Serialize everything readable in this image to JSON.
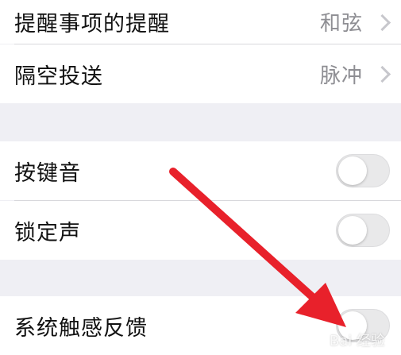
{
  "rows": {
    "reminder_alerts": {
      "label": "提醒事项的提醒",
      "value": "和弦"
    },
    "airdrop": {
      "label": "隔空投送",
      "value": "脉冲"
    },
    "keyboard_clicks": {
      "label": "按键音"
    },
    "lock_sound": {
      "label": "锁定声"
    },
    "system_haptics": {
      "label": "系统触感反馈"
    }
  },
  "watermark": "Bai 经验",
  "colors": {
    "arrow": "#e8212b",
    "toggle_off": "#e9e9ea",
    "background": "#efeff4"
  }
}
